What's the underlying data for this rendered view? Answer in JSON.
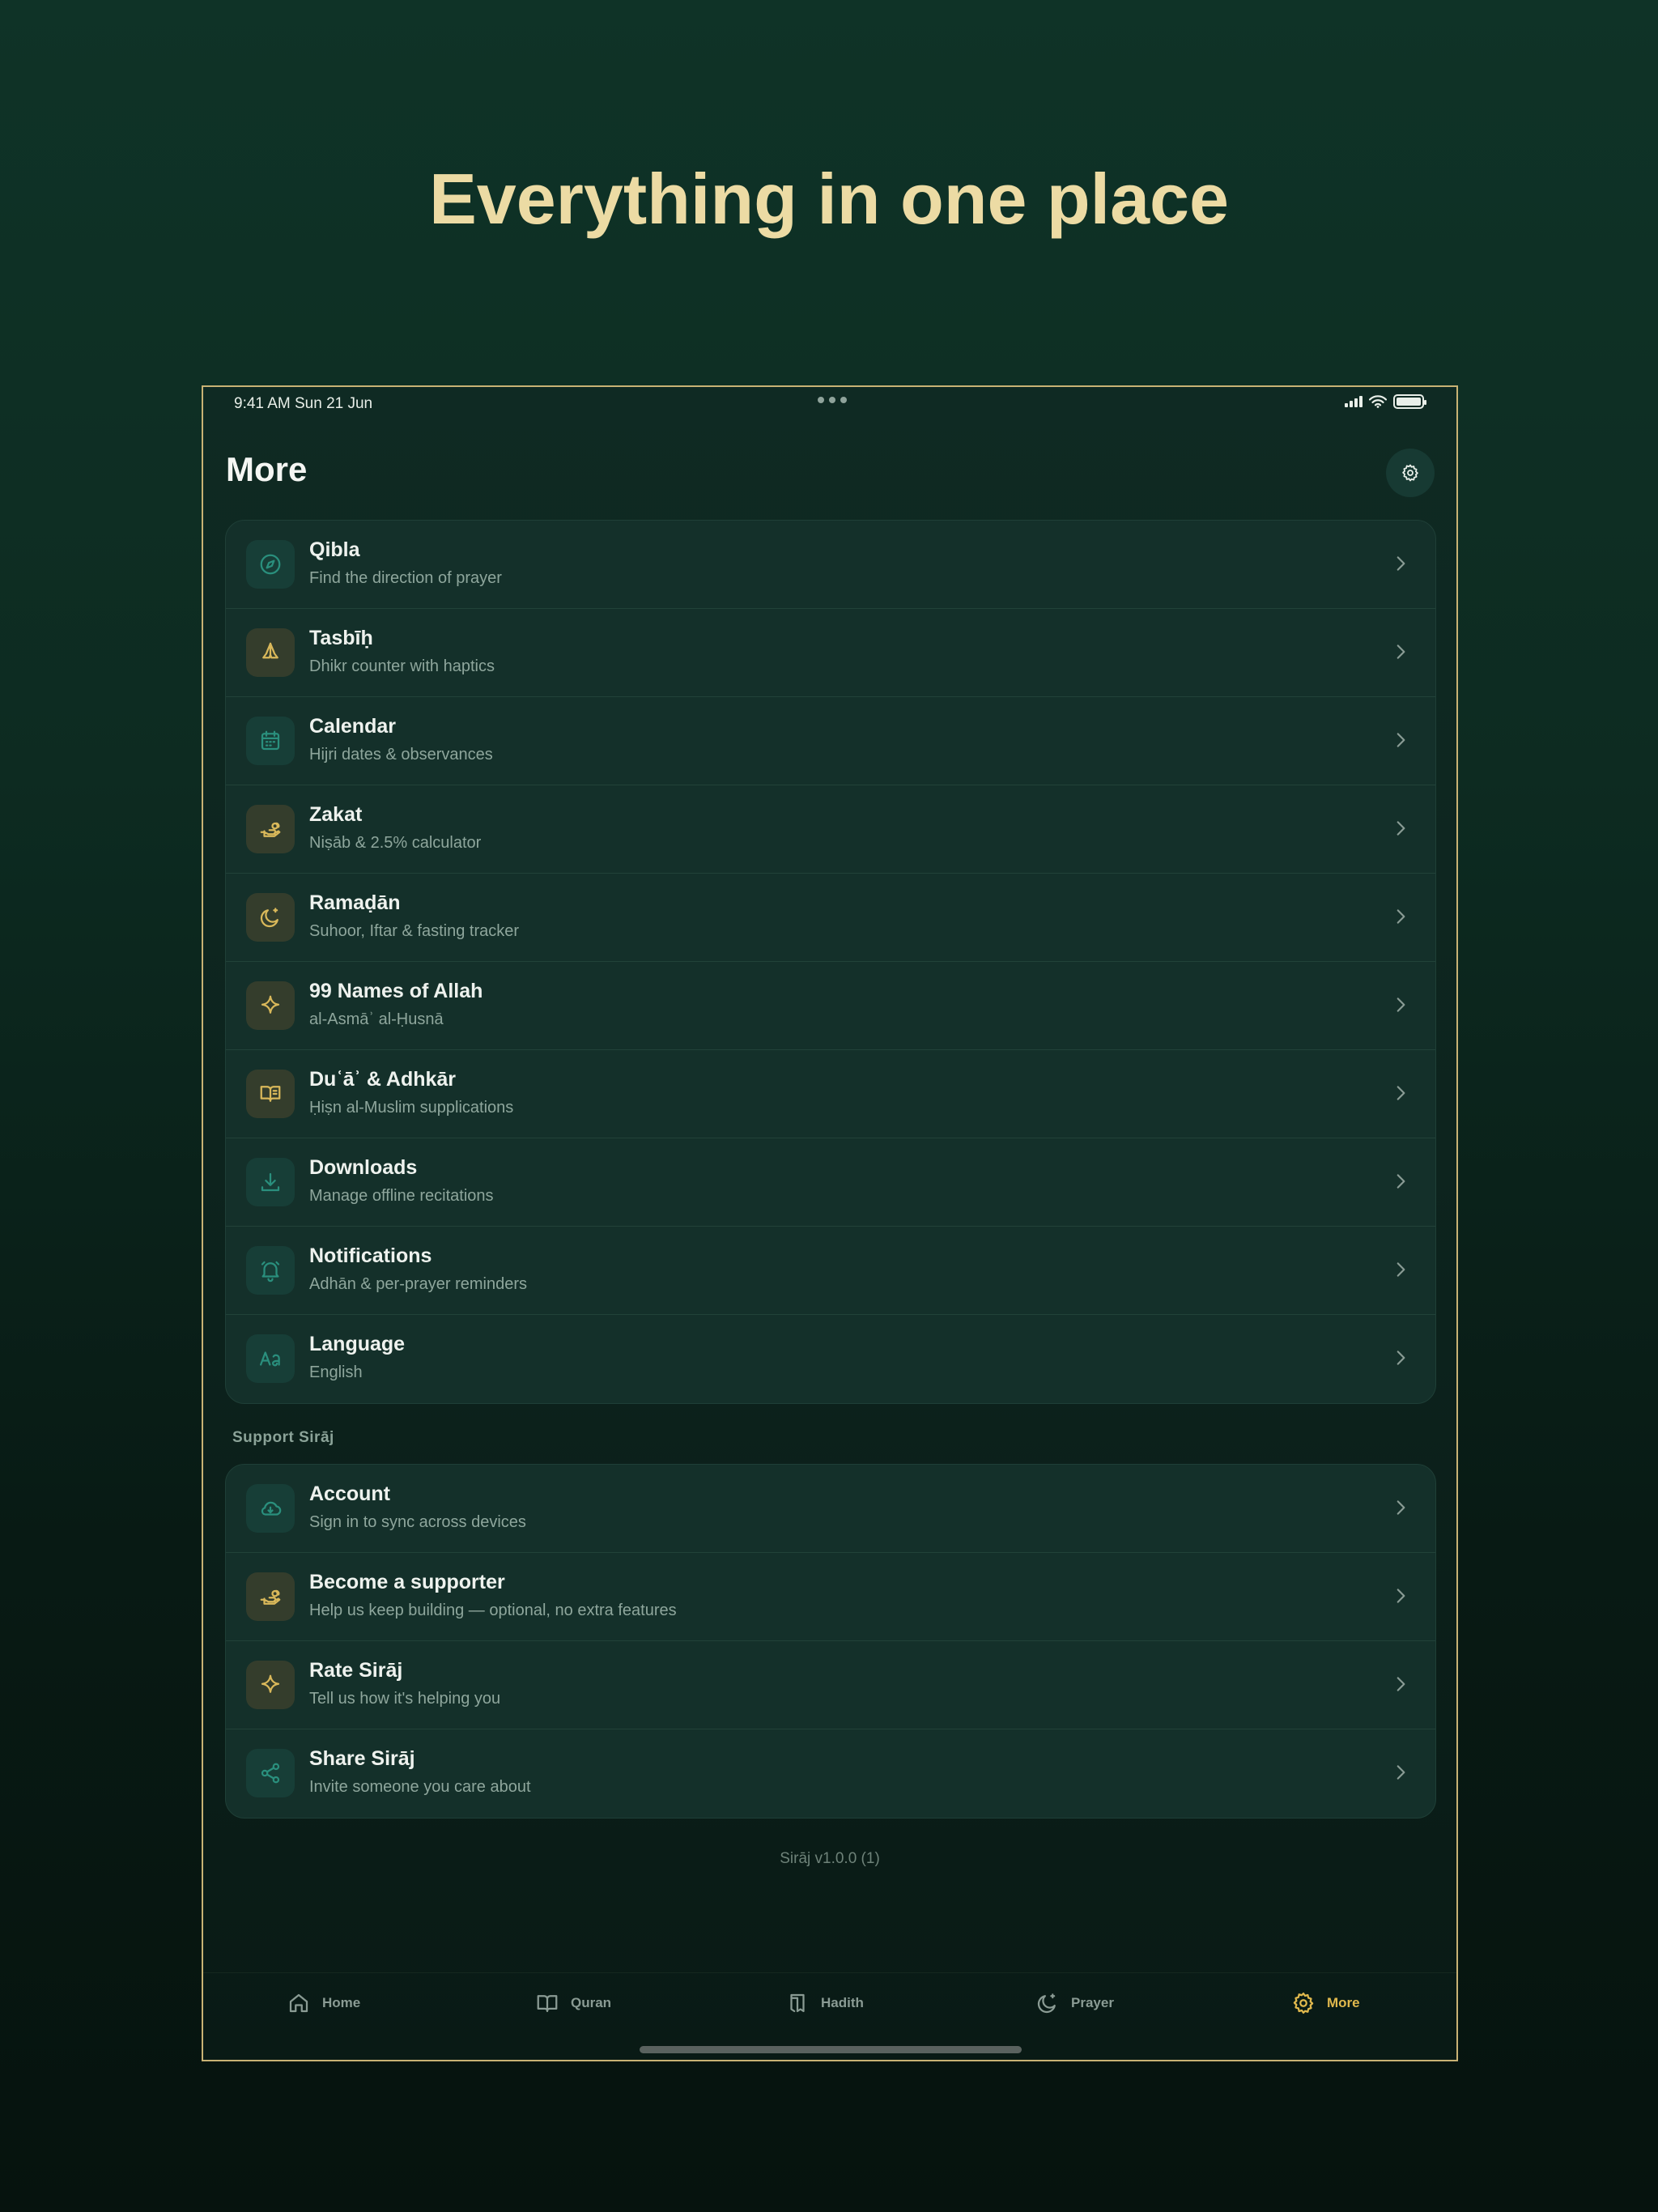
{
  "headline": "Everything in one place",
  "status_bar": {
    "time_date": "9:41 AM   Sun 21 Jun"
  },
  "page": {
    "title": "More"
  },
  "main_items": [
    {
      "title": "Qibla",
      "subtitle": "Find the direction of prayer",
      "icon": "compass-icon"
    },
    {
      "title": "Tasbīḥ",
      "subtitle": "Dhikr counter with haptics",
      "icon": "praying-hands-icon"
    },
    {
      "title": "Calendar",
      "subtitle": "Hijri dates & observances",
      "icon": "calendar-icon"
    },
    {
      "title": "Zakat",
      "subtitle": "Niṣāb & 2.5% calculator",
      "icon": "giving-hand-icon"
    },
    {
      "title": "Ramaḍān",
      "subtitle": "Suhoor, Iftar & fasting tracker",
      "icon": "moon-star-icon"
    },
    {
      "title": "99 Names of Allah",
      "subtitle": "al-Asmāʾ al-Ḥusnā",
      "icon": "sparkle-icon"
    },
    {
      "title": "Duʿāʾ & Adhkār",
      "subtitle": "Ḥiṣn al-Muslim supplications",
      "icon": "open-book-icon"
    },
    {
      "title": "Downloads",
      "subtitle": "Manage offline recitations",
      "icon": "download-icon"
    },
    {
      "title": "Notifications",
      "subtitle": "Adhān & per-prayer reminders",
      "icon": "bell-icon"
    },
    {
      "title": "Language",
      "subtitle": "English",
      "icon": "text-aa-icon"
    }
  ],
  "support": {
    "header": "Support Sirāj",
    "items": [
      {
        "title": "Account",
        "subtitle": "Sign in to sync across devices",
        "icon": "cloud-icon"
      },
      {
        "title": "Become a supporter",
        "subtitle": "Help us keep building — optional, no extra features",
        "icon": "giving-hand-icon"
      },
      {
        "title": "Rate Sirāj",
        "subtitle": "Tell us how it's helping you",
        "icon": "sparkle-icon"
      },
      {
        "title": "Share Sirāj",
        "subtitle": "Invite someone you care about",
        "icon": "share-icon"
      }
    ]
  },
  "version": "Sirāj v1.0.0 (1)",
  "tabs": [
    {
      "label": "Home",
      "icon": "home-icon"
    },
    {
      "label": "Quran",
      "icon": "book-icon"
    },
    {
      "label": "Hadith",
      "icon": "bookmark-book-icon"
    },
    {
      "label": "Prayer",
      "icon": "moon-star-icon"
    },
    {
      "label": "More",
      "icon": "gear-icon",
      "active": true
    }
  ],
  "colors": {
    "accent_gold": "#e0b84d",
    "headline": "#ecdba4",
    "teal_icon": "#2a8f7d",
    "frame": "#c8b274"
  }
}
